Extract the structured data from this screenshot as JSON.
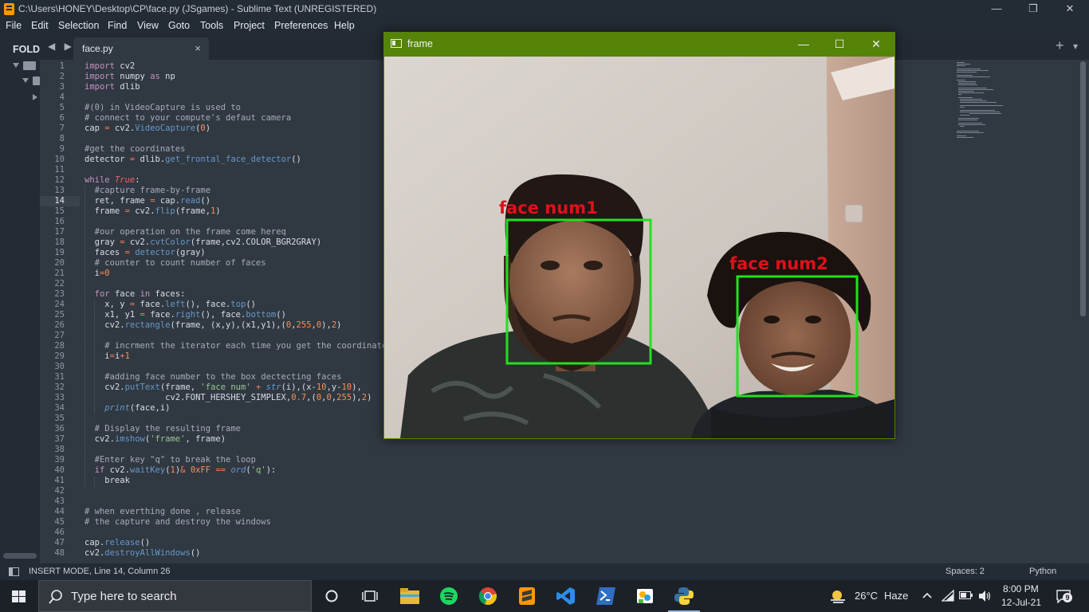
{
  "window": {
    "title": "C:\\Users\\HONEY\\Desktop\\CP\\face.py (JSgames) - Sublime Text (UNREGISTERED)",
    "minimize": "—",
    "maximize": "❐",
    "close": "✕"
  },
  "menu": [
    "File",
    "Edit",
    "Selection",
    "Find",
    "View",
    "Goto",
    "Tools",
    "Project",
    "Preferences",
    "Help"
  ],
  "sidebar": {
    "header": "FOLD"
  },
  "tab": {
    "name": "face.py",
    "close": "×",
    "nav": "◀ ▶",
    "plus": "+",
    "more": "▾"
  },
  "editor": {
    "current_line": 14,
    "line_numbers": [
      "1",
      "2",
      "3",
      "4",
      "5",
      "6",
      "7",
      "8",
      "9",
      "10",
      "11",
      "12",
      "13",
      "14",
      "15",
      "16",
      "17",
      "18",
      "19",
      "20",
      "21",
      "22",
      "23",
      "24",
      "25",
      "26",
      "27",
      "28",
      "29",
      "30",
      "31",
      "32",
      "33",
      "34",
      "35",
      "36",
      "37",
      "38",
      "39",
      "40",
      "41",
      "42",
      "43",
      "44",
      "45",
      "46",
      "47",
      "48"
    ],
    "code_lines": [
      "import cv2",
      "import numpy as np",
      "import dlib",
      "",
      "#(0) in VideoCapture is used to",
      "# connect to your compute's defaut camera",
      "cap = cv2.VideoCapture(0)",
      "",
      "#get the coordinates",
      "detector = dlib.get_frontal_face_detector()",
      "",
      "while True:",
      "  #capture frame-by-frame",
      "  ret, frame = cap.read()",
      "  frame = cv2.flip(frame,1)",
      "",
      "  #our operation on the frame come hereq",
      "  gray = cv2.cvtColor(frame,cv2.COLOR_BGR2GRAY)",
      "  faces = detector(gray)",
      "  # counter to count number of faces",
      "  i=0",
      "",
      "  for face in faces:",
      "    x, y = face.left(), face.top()",
      "    x1, y1 = face.right(), face.bottom()",
      "    cv2.rectangle(frame, (x,y),(x1,y1),(0,255,0),2)",
      "",
      "    # incrment the iterator each time you get the coordinates",
      "    i=i+1",
      "",
      "    #adding face number to the box dectecting faces",
      "    cv2.putText(frame, 'face num' + str(i),(x-10,y-10),",
      "                cv2.FONT_HERSHEY_SIMPLEX,0.7,(0,0,255),2)",
      "    print(face,i)",
      "",
      "  # Display the resulting frame",
      "  cv2.imshow('frame', frame)",
      "",
      "  #Enter key \"q\" to break the loop",
      "  if cv2.waitKey(1)& 0xFF == ord('q'):",
      "    break",
      "",
      "",
      "# when everthing done , release",
      "# the capture and destroy the windows",
      "",
      "cap.release()",
      "cv2.destroyAllWindows()"
    ]
  },
  "status": {
    "mode": "INSERT MODE, Line 14, Column 26",
    "spaces": "Spaces: 2",
    "syntax": "Python"
  },
  "frame_window": {
    "title": "frame",
    "minimize": "—",
    "maximize": "☐",
    "close": "✕",
    "face_labels": [
      "face num1",
      "face num2"
    ],
    "box_color": "#22e01e",
    "label_color": "#e0101a"
  },
  "taskbar": {
    "search_placeholder": "Type here to search",
    "weather_temp": "26°C",
    "weather_text": "Haze",
    "time": "8:00 PM",
    "date": "12-Jul-21",
    "notifications": "9",
    "apps": [
      "task-view",
      "explorer",
      "spotify",
      "chrome",
      "sublime-text",
      "vscode",
      "powershell",
      "paint",
      "python"
    ]
  },
  "colors": {
    "editor_bg": "#303841",
    "chrome_bg": "#232b35",
    "frame_titlebar": "#56830a",
    "taskbar_bg": "#1c2128"
  }
}
